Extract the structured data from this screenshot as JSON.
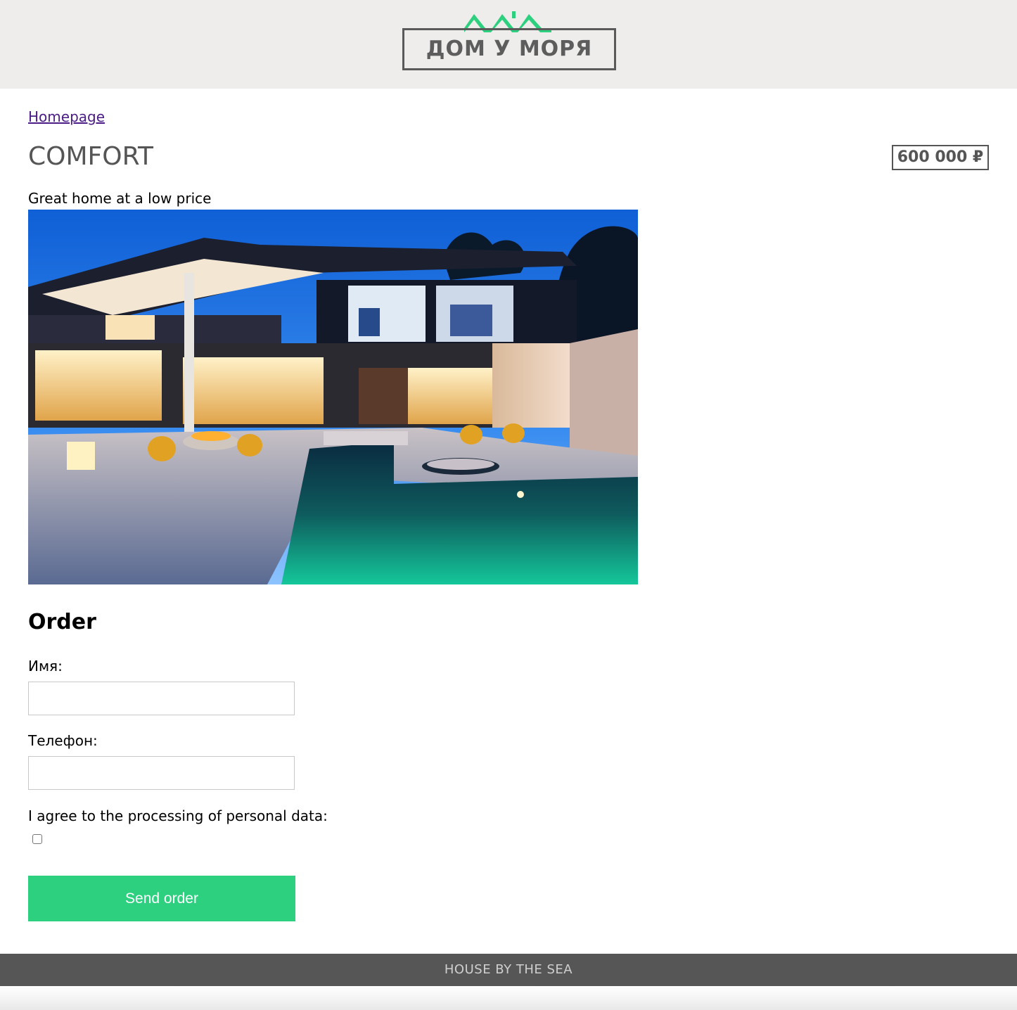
{
  "header": {
    "logo_text": "ДОМ У МОРЯ",
    "logo_icon": "house-roofs-icon",
    "accent_color": "#2dd07e"
  },
  "breadcrumb": {
    "home_label": "Homepage"
  },
  "product": {
    "title": "COMFORT",
    "price": "600 000 ₽",
    "description": "Great home at a low price",
    "image_icon": "modern-house-photo"
  },
  "order": {
    "title": "Order",
    "name_label": "Имя:",
    "name_value": "",
    "phone_label": "Телефон:",
    "phone_value": "",
    "consent_label": "I agree to the processing of personal data:",
    "consent_checked": false,
    "submit_label": "Send order"
  },
  "footer": {
    "text": "HOUSE BY THE SEA"
  }
}
